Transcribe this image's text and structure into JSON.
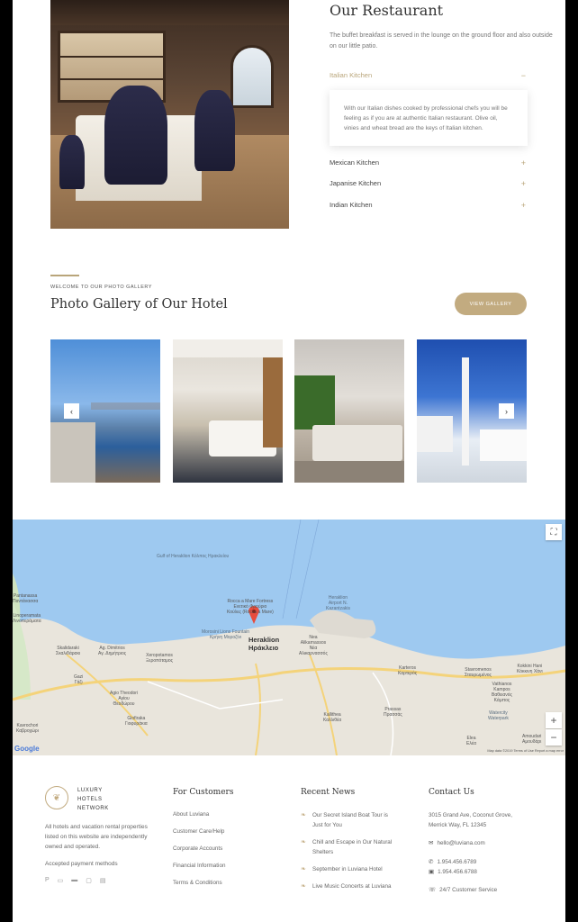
{
  "restaurant": {
    "title": "Our Restaurant",
    "description": "The buffet breakfast is served in the lounge on the ground floor and also outside on our little patio.",
    "accordion": [
      {
        "label": "Italian Kitchen",
        "sign": "−",
        "open": true,
        "text": "With our Italian dishes cooked by professional chefs you will be feeling as if you are at authentic Italian restaurant. Olive oil, vinies and wheat bread are the keys of Italian kitchen."
      },
      {
        "label": "Mexican Kitchen",
        "sign": "+"
      },
      {
        "label": "Japanise Kitchen",
        "sign": "+"
      },
      {
        "label": "Indian Kitchen",
        "sign": "+"
      }
    ]
  },
  "gallery": {
    "kicker": "WELCOME TO OUR PHOTO GALLERY",
    "title": "Photo Gallery of Our Hotel",
    "button": "VIEW GALLERY",
    "prev_icon": "‹",
    "next_icon": "›"
  },
  "map": {
    "city_en": "Heraklion",
    "city_gr": "Ηράκλειο",
    "labels": [
      {
        "text": "Gulf of Heraklion\nΚόλπος Ηρακλείου"
      },
      {
        "text": "Rocca a Mare Fortress\nΕνετικό Φρούριο\nΚούλες (Rocca a Mare)"
      },
      {
        "text": "Heraklion\nAirport N.\nKazantzakis"
      },
      {
        "text": "Morosini Lions Fountain\nΚρήνη Μοροζίνι"
      },
      {
        "text": "Skalidaraki\nΣκαλιδάρακι"
      },
      {
        "text": "Ag. Dimitrios\nΑγ. Δημήτριος"
      },
      {
        "text": "Xeropotamos\nΞεροπόταμος"
      },
      {
        "text": "Nea\nAlikarnassos\nΝέα\nΑλικαρνασσός"
      },
      {
        "text": "Karteros\nΚαρτερός"
      },
      {
        "text": "Stavromenos\nΣταυρωμένος"
      },
      {
        "text": "Kokkini Hani\nΚόκκινη Χάνι"
      },
      {
        "text": "Vathianos\nKampos\nΒαθειανός\nΚάμπος"
      },
      {
        "text": "Watercity\nWaterpark"
      },
      {
        "text": "Kallithea\nΚαλλιθέα"
      },
      {
        "text": "Prassas\nΠρασσάς"
      },
      {
        "text": "Gazi\nΓάζι"
      },
      {
        "text": "Agio Theodori\nΑγίου\nΘεοδώρου"
      },
      {
        "text": "Giofiraka\nΓιοφυράκια"
      },
      {
        "text": "Kavrochori\nΚαβροχώρι"
      },
      {
        "text": "Elea\nΕλέα"
      },
      {
        "text": "Amoudari\nΑμουδάρι"
      },
      {
        "text": "Linoperamata\nΛινοπεράματα"
      },
      {
        "text": "Pantanassa\nΠαντάνασσα"
      }
    ],
    "zoom_in": "+",
    "zoom_out": "−",
    "fullscreen_icon": "⛶",
    "google": "Google",
    "info": "Map data ©2019   Terms of Use   Report a map error"
  },
  "footer": {
    "brand_lines": [
      "LUXURY",
      "HOTELS",
      "NETWORK"
    ],
    "about": "All hotels and vacation rental properties listed on this website are independently owned and operated.",
    "accepted": "Accepted payment methods",
    "payment_icons": [
      "paypal-icon",
      "card-icon",
      "amex-icon",
      "visa-icon",
      "mastercard-icon"
    ],
    "customers": {
      "title": "For Customers",
      "links": [
        "About Luviana",
        "Customer Care/Help",
        "Corporate Accounts",
        "Financial Information",
        "Terms & Conditions"
      ]
    },
    "news": {
      "title": "Recent News",
      "items": [
        "Our Secret Island Boat Tour is Just for You",
        "Chill and Escape in Our Natural Shelters",
        "September in Luviana Hotel",
        "Live Music Concerts at Luviana"
      ]
    },
    "contact": {
      "title": "Contact Us",
      "address": "3015 Grand Ave, Coconut Grove, Merrick Way, FL 12345",
      "email": "hello@luviana.com",
      "phone": "1.954.456.6789",
      "fax": "1.954.456.6788",
      "service": "24/7 Customer Service"
    }
  },
  "colors": {
    "accent": "#c2ab80",
    "water": "#9ec9f0",
    "land": "#e9e5dc"
  }
}
